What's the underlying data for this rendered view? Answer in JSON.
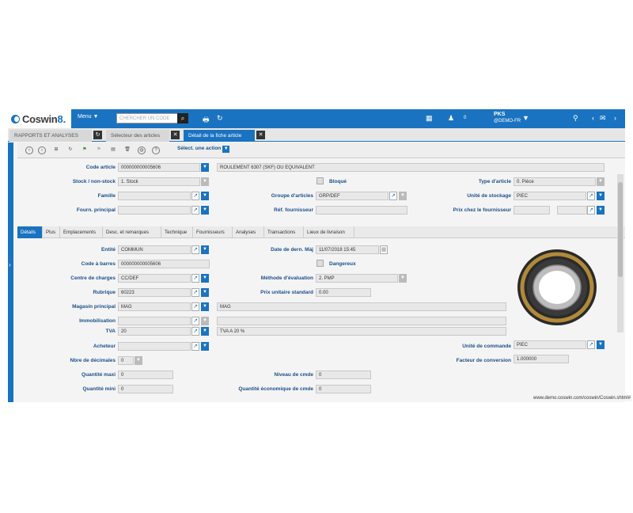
{
  "app": {
    "logo_text": "Coswin",
    "logo_version": "8.",
    "menu_label": "Menu",
    "search_placeholder": "CHERCHER UN CODE",
    "notif_count": "0",
    "user_name": "PKS",
    "user_domain": "@DEMO-FR"
  },
  "tabs": [
    {
      "label": "RAPPORTS ET ANALYSES"
    },
    {
      "label": "Sélecteur des articles"
    },
    {
      "label": "Détail de la fiche article"
    }
  ],
  "toolbar": {
    "action_label": "Sélect. une action"
  },
  "header_fields": {
    "code_article_label": "Code article",
    "code_article_value": "000000000005606",
    "description_value": "ROULEMENT 6307 (SKF) OU EQUIVALENT",
    "stock_label": "Stock / non-stock",
    "stock_value": "1. Stock",
    "bloque_label": "Bloqué",
    "type_label": "Type d'article",
    "type_value": "0. Pièce",
    "famille_label": "Famille",
    "groupe_label": "Groupe d'articles",
    "groupe_value": "GRP/DEF",
    "unite_stockage_label": "Unité de stockage",
    "unite_stockage_value": "PIEC",
    "fourn_label": "Fourn. principal",
    "ref_fourn_label": "Réf. fournisseur",
    "prix_fourn_label": "Prix chez le fournisseur"
  },
  "subtabs": [
    {
      "label": "Détails"
    },
    {
      "label": "Plus"
    },
    {
      "label": "Emplacements"
    },
    {
      "label": "Desc. et remarques"
    },
    {
      "label": "Technique"
    },
    {
      "label": "Fournisseurs"
    },
    {
      "label": "Analyses"
    },
    {
      "label": "Transactions"
    },
    {
      "label": "Lieux de livraison"
    }
  ],
  "details": {
    "entite_label": "Entité",
    "entite_value": "COMMUN",
    "date_maj_label": "Date de dern. Màj",
    "date_maj_value": "11/07/2018 15:45",
    "code_barres_label": "Code à barres",
    "code_barres_value": "000000000005606",
    "dangereux_label": "Dangereux",
    "centre_label": "Centre de charges",
    "centre_value": "CC/DEF",
    "methode_label": "Méthode d'évaluation",
    "methode_value": "2. PMP",
    "rubrique_label": "Rubrique",
    "rubrique_value": "60223",
    "prix_unitaire_label": "Prix unitaire standard",
    "prix_unitaire_value": "0.00",
    "magasin_label": "Magasin principal",
    "magasin_value": "MAG",
    "magasin_desc": "MAG",
    "immob_label": "Immobilisation",
    "tva_label": "TVA",
    "tva_value": "20",
    "tva_desc": "TVA A 20 %",
    "acheteur_label": "Acheteur",
    "unite_cmd_label": "Unité de commande",
    "unite_cmd_value": "PIEC",
    "decimales_label": "Nbre de décimales",
    "decimales_value": "0",
    "facteur_label": "Facteur de conversion",
    "facteur_value": "1.000000",
    "qte_maxi_label": "Quantité maxi",
    "qte_maxi_value": "0",
    "niveau_label": "Niveau de cmde",
    "niveau_value": "0",
    "qte_mini_label": "Quantité mini",
    "qte_mini_value": "0",
    "qte_eco_label": "Quantité économique de cmde",
    "qte_eco_value": "0"
  },
  "status_url": "www.demo.coswin.com/coswin/Coswin.shtml#",
  "colors": {
    "accent": "#1a73c0"
  }
}
